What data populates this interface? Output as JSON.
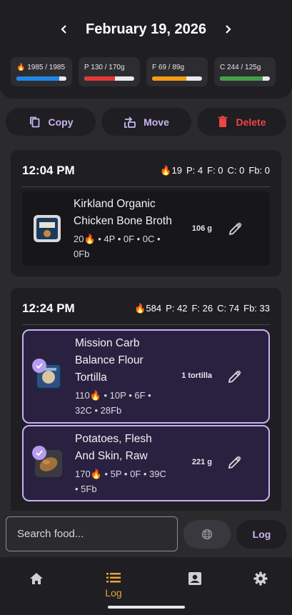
{
  "header": {
    "date": "February 19, 2026",
    "macros": [
      {
        "label": "🔥 1985 / 1985",
        "color": "#1e88e5",
        "fill_fraction": 0.86
      },
      {
        "label": "P 130 / 170g",
        "color": "#e53935",
        "fill_fraction": 0.62
      },
      {
        "label": "F 69 / 89g",
        "color": "#f39c12",
        "fill_fraction": 0.68
      },
      {
        "label": "C 244 / 125g",
        "color": "#43a047",
        "fill_fraction": 0.86
      }
    ]
  },
  "actions": {
    "copy_label": "Copy",
    "move_label": "Move",
    "delete_label": "Delete"
  },
  "meals": [
    {
      "time": "12:04 PM",
      "calories": "19",
      "protein": "P: 4",
      "fat": "F: 0",
      "carbs": "C: 0",
      "fiber": "Fb: 0",
      "items": [
        {
          "name_line1": "Kirkland Organic",
          "name_line2": "Chicken Bone Broth",
          "stats_line1": "20🔥 • 4P • 0F • 0C •",
          "stats_line2": "0Fb",
          "quantity": "106 g"
        }
      ]
    },
    {
      "time": "12:24 PM",
      "calories": "584",
      "protein": "P: 42",
      "fat": "F: 26",
      "carbs": "C: 74",
      "fiber": "Fb: 33",
      "items": [
        {
          "name_line1": "Mission Carb",
          "name_line2": "Balance Flour",
          "name_line3": "Tortilla",
          "stats_line1": "110🔥 • 10P • 6F •",
          "stats_line2": "32C • 28Fb",
          "quantity": "1 tortilla"
        },
        {
          "name_line1": "Potatoes, Flesh",
          "name_line2": "And Skin, Raw",
          "stats_line1": "170🔥 • 5P • 0F • 39C",
          "stats_line2": "• 5Fb",
          "quantity": "221 g"
        }
      ]
    }
  ],
  "search": {
    "placeholder": "Search food..."
  },
  "log_button": "Log",
  "nav": {
    "log_label": "Log"
  },
  "colors": {
    "accent": "#c9b6f2",
    "active_tab": "#e8a33a",
    "danger": "#ee4444"
  }
}
